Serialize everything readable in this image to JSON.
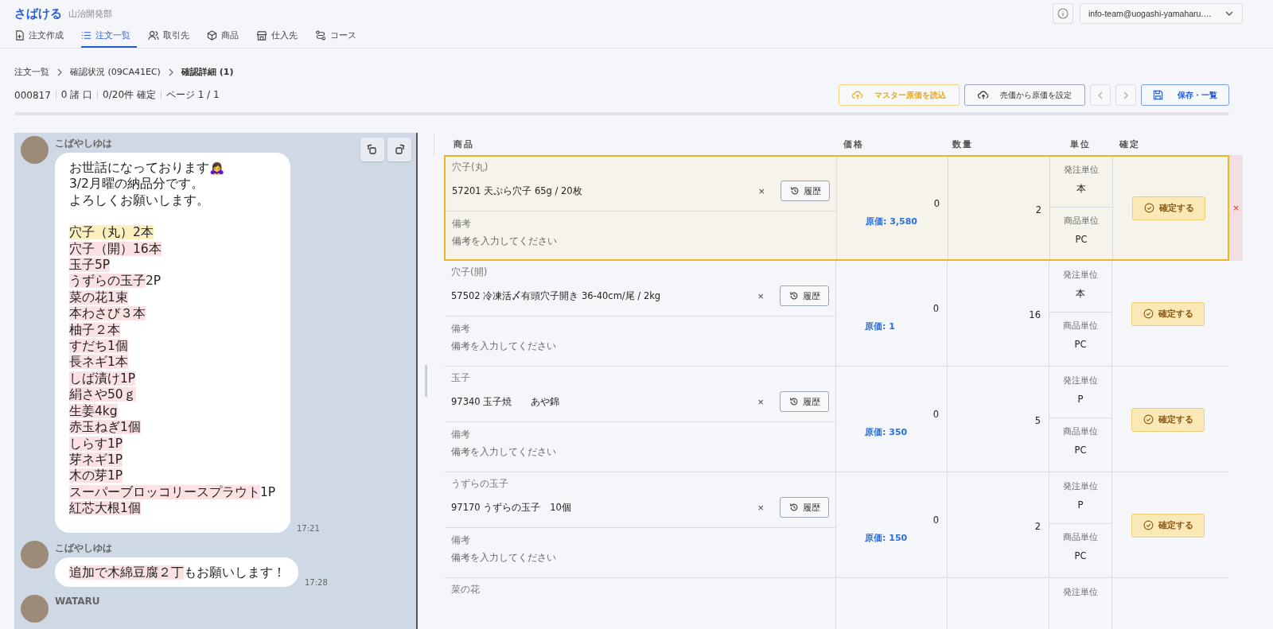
{
  "app": {
    "logo": "さばける",
    "org": "山治開発部"
  },
  "tabs": [
    {
      "label": "注文作成",
      "kind": "create",
      "selected": false
    },
    {
      "label": "注文一覧",
      "kind": "list",
      "selected": true
    },
    {
      "label": "取引先",
      "kind": "clients",
      "selected": false
    },
    {
      "label": "商品",
      "kind": "products",
      "selected": false
    },
    {
      "label": "仕入先",
      "kind": "suppliers",
      "selected": false
    },
    {
      "label": "コース",
      "kind": "courses",
      "selected": false
    }
  ],
  "account": {
    "email": "info-team@uogashi-yamaharu.…"
  },
  "breadcrumb": [
    {
      "label": "注文一覧",
      "current": false
    },
    {
      "label": "確認状況 (09CA41EC)",
      "current": false
    },
    {
      "label": "確認詳細 (1)",
      "current": true
    }
  ],
  "stats": [
    "000817",
    "0 諸 口",
    "0/20件 確定",
    "ページ 1 / 1"
  ],
  "actions": [
    {
      "label": "マスター原価を読込",
      "kind": "warn"
    },
    {
      "label": "売価から原価を設定",
      "kind": "plain"
    },
    {
      "label": "保存・一覧",
      "kind": "primary"
    }
  ],
  "chat": {
    "messages": [
      {
        "sender": "こばやしゆは",
        "time": "17:21",
        "paragraphs": [
          [
            [
              {
                "text": "お世話になっております🙇‍♀️"
              }
            ],
            [
              {
                "text": "3/2月曜の納品分です。"
              }
            ],
            [
              {
                "text": "よろしくお願いします。"
              }
            ]
          ],
          [
            [
              {
                "text": "穴子（丸）2本",
                "color": "#fbefbf"
              }
            ],
            [
              {
                "text": "穴子（開）16本",
                "color": "#fbe1e2"
              }
            ],
            [
              {
                "text": "玉子5P",
                "color": "#fbe1e2"
              }
            ],
            [
              {
                "text": "うずらの玉子",
                "color": "#fbe1e2"
              },
              {
                "text": "2P"
              }
            ],
            [
              {
                "text": "菜の花1束",
                "color": "#fbe1e2"
              }
            ],
            [
              {
                "text": "本わさび３本",
                "color": "#fbe1e2"
              }
            ],
            [
              {
                "text": "柚子２本",
                "color": "#fbe1e2"
              }
            ],
            [
              {
                "text": "すだち1個",
                "color": "#fbe1e2"
              }
            ],
            [
              {
                "text": "長ネギ1本",
                "color": "#fbe1e2"
              }
            ],
            [
              {
                "text": "しば漬け1P",
                "color": "#fbe1e2"
              }
            ],
            [
              {
                "text": "絹さや50ｇ",
                "color": "#fbe1e2"
              }
            ],
            [
              {
                "text": "生姜4kg",
                "color": "#fbe1e2"
              }
            ],
            [
              {
                "text": "赤玉ねぎ1個",
                "color": "#fbe1e2"
              }
            ],
            [
              {
                "text": "しらす1P",
                "color": "#fbe1e2"
              }
            ],
            [
              {
                "text": "芽ネギ1P",
                "color": "#fbe1e2"
              }
            ],
            [
              {
                "text": "木の芽1P",
                "color": "#fbe1e2"
              }
            ],
            [
              {
                "text": "スーパーブロッコリースプラウト",
                "color": "#fbe1e2"
              },
              {
                "text": "1P"
              }
            ],
            [
              {
                "text": "紅芯大根1個",
                "color": "#fbe1e2"
              }
            ]
          ]
        ]
      },
      {
        "sender": "こばやしゆは",
        "time": "17:28",
        "paragraphs": [
          [
            [
              {
                "text": "追加で木綿豆腐２丁",
                "color": "#fbe1e2"
              },
              {
                "text": "もお願いします！"
              }
            ]
          ]
        ]
      },
      {
        "sender": "WATARU"
      }
    ]
  },
  "table": {
    "columns": [
      "商品",
      "価格",
      "数量",
      "単位",
      "確定"
    ],
    "rows": [
      {
        "selected": true,
        "label": "穴子(丸)",
        "product": "57201 天ぷら穴子 65g / 20枚",
        "clear": "×",
        "history": "履歴",
        "note_label": "備考",
        "note_placeholder": "備考を入力してください",
        "price": "0",
        "cost": "原価: 3,580",
        "quantity": "2",
        "order_unit_label": "発注単位",
        "order_unit": "本",
        "item_unit_label": "商品単位",
        "item_unit": "PC",
        "confirm": "確定する",
        "remove": "×"
      },
      {
        "selected": false,
        "label": "穴子(開)",
        "product": "57502 冷凍活〆有頭穴子開き 36-40cm/尾 / 2kg",
        "clear": "×",
        "history": "履歴",
        "note_label": "備考",
        "note_placeholder": "備考を入力してください",
        "price": "0",
        "cost": "原価: 1",
        "quantity": "16",
        "order_unit_label": "発注単位",
        "order_unit": "本",
        "item_unit_label": "商品単位",
        "item_unit": "PC",
        "confirm": "確定する"
      },
      {
        "selected": false,
        "label": "玉子",
        "product": "97340 玉子焼　　あや錦",
        "clear": "×",
        "history": "履歴",
        "note_label": "備考",
        "note_placeholder": "備考を入力してください",
        "price": "0",
        "cost": "原価: 350",
        "quantity": "5",
        "order_unit_label": "発注単位",
        "order_unit": "P",
        "item_unit_label": "商品単位",
        "item_unit": "PC",
        "confirm": "確定する"
      },
      {
        "selected": false,
        "label": "うずらの玉子",
        "product": "97170 うずらの玉子　10個",
        "clear": "×",
        "history": "履歴",
        "note_label": "備考",
        "note_placeholder": "備考を入力してください",
        "price": "0",
        "cost": "原価: 150",
        "quantity": "2",
        "order_unit_label": "発注単位",
        "order_unit": "P",
        "item_unit_label": "商品単位",
        "item_unit": "PC",
        "confirm": "確定する"
      },
      {
        "selected": false,
        "label": "菜の花",
        "order_unit_label": "発注単位"
      }
    ]
  }
}
